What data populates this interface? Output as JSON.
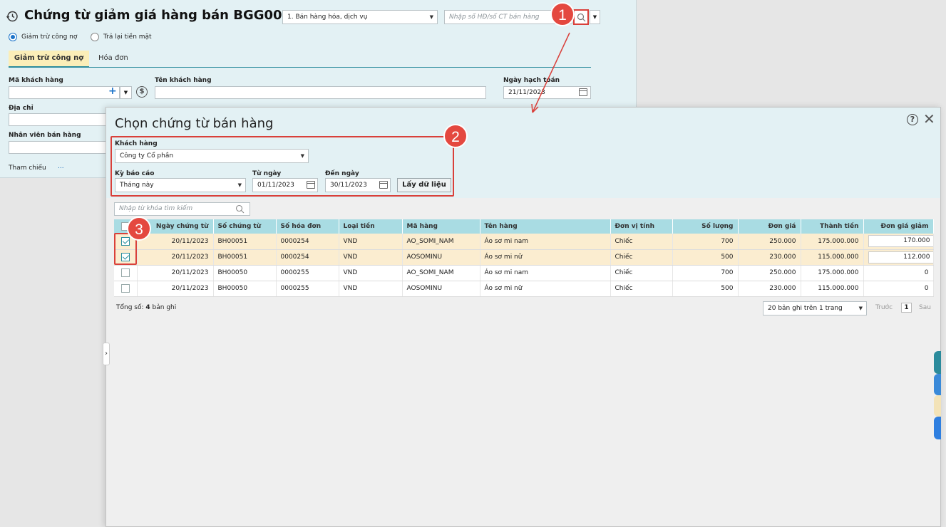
{
  "header": {
    "title": "Chứng từ giảm giá hàng bán BGG00001",
    "type_select": "1. Bán hàng hóa, dịch vụ",
    "search_placeholder": "Nhập số HĐ/số CT bán hàng"
  },
  "radios": {
    "option1": "Giảm trừ công nợ",
    "option2": "Trả lại tiền mặt"
  },
  "tabs": {
    "tab1": "Giảm trừ công nợ",
    "tab2": "Hóa đơn"
  },
  "form": {
    "customer_code_label": "Mã khách hàng",
    "customer_name_label": "Tên khách hàng",
    "posting_date_label": "Ngày hạch toán",
    "posting_date": "21/11/2023",
    "address_label": "Địa chỉ",
    "salesperson_label": "Nhân viên bán hàng",
    "reference_label": "Tham chiếu",
    "reference_more": "...",
    "add_symbol": "+"
  },
  "dialog": {
    "title": "Chọn chứng từ bán hàng",
    "customer_label": "Khách hàng",
    "customer_value": "Công ty Cổ phần",
    "period_label": "Kỳ báo cáo",
    "period_value": "Tháng này",
    "from_label": "Từ ngày",
    "from_value": "01/11/2023",
    "to_label": "Đến ngày",
    "to_value": "30/11/2023",
    "fetch_button": "Lấy dữ liệu",
    "search_placeholder": "Nhập từ khóa tìm kiếm",
    "help": "?",
    "close": "✕"
  },
  "table": {
    "columns": [
      "Ngày chứng từ",
      "Số chứng từ",
      "Số hóa đơn",
      "Loại tiền",
      "Mã hàng",
      "Tên hàng",
      "Đơn vị tính",
      "Số lượng",
      "Đơn giá",
      "Thành tiền",
      "Đơn giá giảm"
    ],
    "rows": [
      {
        "checked": true,
        "date": "20/11/2023",
        "voucher": "BH00051",
        "invoice": "0000254",
        "currency": "VND",
        "code": "AO_SOMI_NAM",
        "name": "Áo sơ mi nam",
        "unit": "Chiếc",
        "qty": "700",
        "price": "250.000",
        "amount": "175.000.000",
        "discount": "170.000"
      },
      {
        "checked": true,
        "date": "20/11/2023",
        "voucher": "BH00051",
        "invoice": "0000254",
        "currency": "VND",
        "code": "AOSOMINU",
        "name": "Áo sơ mi nữ",
        "unit": "Chiếc",
        "qty": "500",
        "price": "230.000",
        "amount": "115.000.000",
        "discount": "112.000"
      },
      {
        "checked": false,
        "date": "20/11/2023",
        "voucher": "BH00050",
        "invoice": "0000255",
        "currency": "VND",
        "code": "AO_SOMI_NAM",
        "name": "Áo sơ mi nam",
        "unit": "Chiếc",
        "qty": "700",
        "price": "250.000",
        "amount": "175.000.000",
        "discount": "0"
      },
      {
        "checked": false,
        "date": "20/11/2023",
        "voucher": "BH00050",
        "invoice": "0000255",
        "currency": "VND",
        "code": "AOSOMINU",
        "name": "Áo sơ mi nữ",
        "unit": "Chiếc",
        "qty": "500",
        "price": "230.000",
        "amount": "115.000.000",
        "discount": "0"
      }
    ]
  },
  "footer": {
    "total_prefix": "Tổng số:",
    "total_count": "4",
    "total_suffix": "bản ghi",
    "page_size": "20 bản ghi trên 1 trang",
    "prev": "Trước",
    "page": "1",
    "next": "Sau"
  },
  "annotations": {
    "step1": "1",
    "step2": "2",
    "step3": "3"
  },
  "colors": {
    "accent": "#2b8b9c",
    "header_bg": "#e3f1f4",
    "table_header": "#a9dce3",
    "selected_row": "#fbedd0",
    "annotation": "#e4483f",
    "link": "#1a6bb5"
  }
}
